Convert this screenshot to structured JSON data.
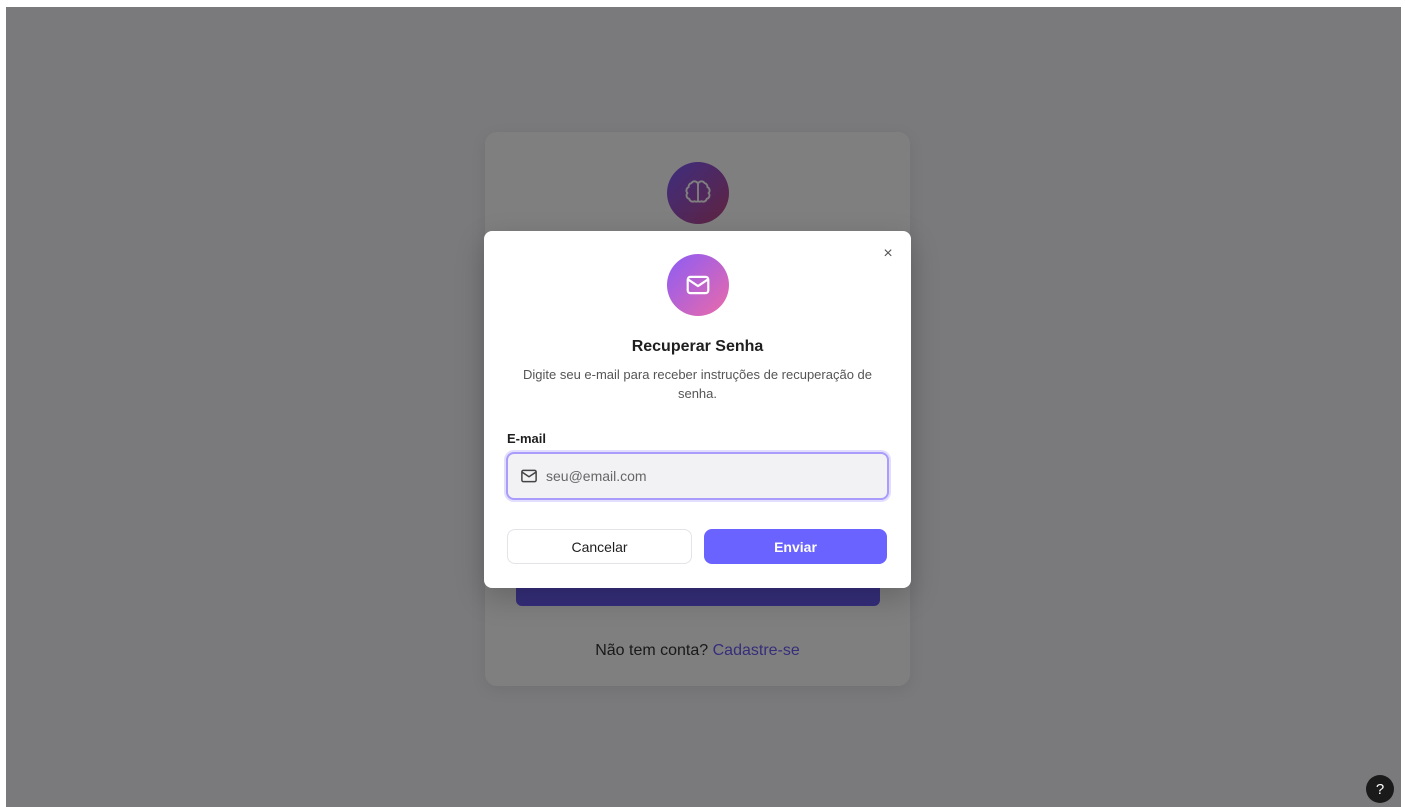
{
  "login": {
    "signup_prompt": "Não tem conta?",
    "signup_link": "Cadastre-se",
    "logo_icon": "brain-icon"
  },
  "modal": {
    "icon": "mail-icon",
    "title": "Recuperar Senha",
    "description": "Digite seu e-mail para receber instruções de recuperação de senha.",
    "email_label": "E-mail",
    "email_value": "",
    "email_placeholder": "seu@email.com",
    "cancel_label": "Cancelar",
    "send_label": "Enviar",
    "close_symbol": "×"
  },
  "help": {
    "label": "?"
  },
  "colors": {
    "primary": "#6b63ff",
    "overlay": "rgba(0,0,0,0.5)",
    "icon_gradient_start": "#8b5cf6",
    "icon_gradient_end": "#ec6aa8"
  }
}
